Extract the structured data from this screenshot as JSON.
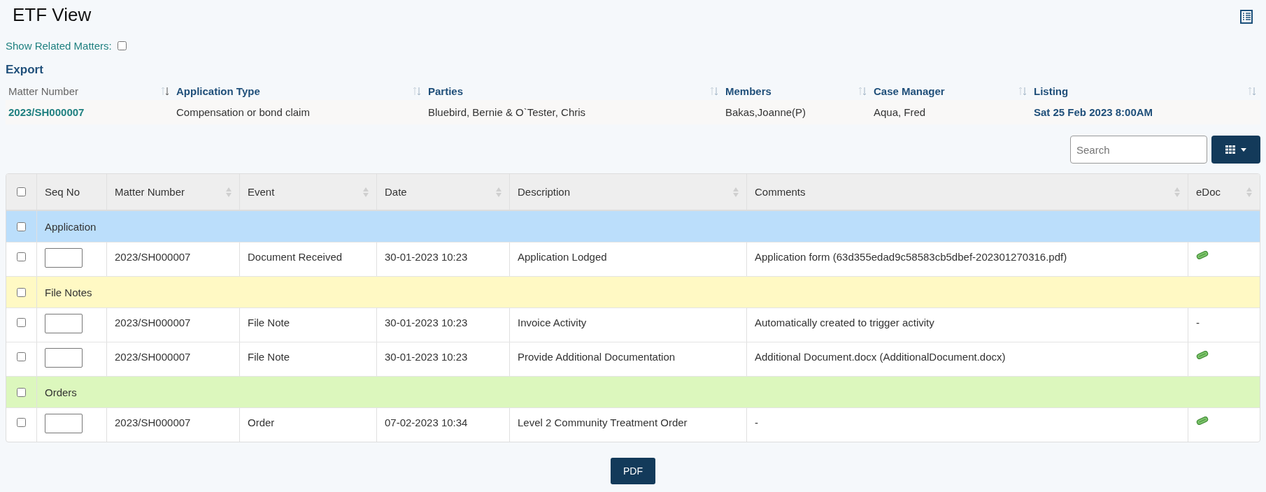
{
  "page": {
    "title": "ETF View"
  },
  "show_related": {
    "label": "Show Related Matters:",
    "checked": false
  },
  "export": {
    "title": "Export",
    "columns": [
      "Matter Number",
      "Application Type",
      "Parties",
      "Members",
      "Case Manager",
      "Listing"
    ],
    "values": [
      "2023/SH000007",
      "Compensation or bond claim",
      "Bluebird, Bernie & O`Tester, Chris",
      "Bakas,Joanne(P)",
      "Aqua, Fred",
      "Sat 25 Feb 2023 8:00AM"
    ]
  },
  "search": {
    "placeholder": "Search"
  },
  "table": {
    "select_all_checked": false,
    "columns": [
      "Seq No",
      "Matter Number",
      "Event",
      "Date",
      "Description",
      "Comments",
      "eDoc"
    ],
    "rows": [
      {
        "kind": "group",
        "label": "Application",
        "color": "#bbdefb",
        "checked": false
      },
      {
        "kind": "item",
        "checked": false,
        "matter": "2023/SH000007",
        "event": "Document Received",
        "date": "30-01-2023 10:23",
        "description": "Application Lodged",
        "comments": "Application form (63d355edad9c58583cb5dbef-202301270316.pdf)",
        "edoc": {
          "kind": "icon"
        }
      },
      {
        "kind": "group",
        "label": "File Notes",
        "color": "#fff9c4",
        "checked": false
      },
      {
        "kind": "item",
        "checked": false,
        "matter": "2023/SH000007",
        "event": "File Note",
        "date": "30-01-2023 10:23",
        "description": "Invoice Activity",
        "comments": "Automatically created to trigger activity",
        "edoc": {
          "kind": "text",
          "text": "-"
        }
      },
      {
        "kind": "item",
        "checked": false,
        "matter": "2023/SH000007",
        "event": "File Note",
        "date": "30-01-2023 10:23",
        "description": "Provide Additional Documentation",
        "comments": "Additional Document.docx (AdditionalDocument.docx)",
        "edoc": {
          "kind": "icon"
        }
      },
      {
        "kind": "group",
        "label": "Orders",
        "color": "#dcf7bd",
        "checked": false
      },
      {
        "kind": "item",
        "checked": false,
        "matter": "2023/SH000007",
        "event": "Order",
        "date": "07-02-2023 10:34",
        "description": "Level 2 Community Treatment Order",
        "comments": "-",
        "edoc": {
          "kind": "icon"
        }
      }
    ]
  },
  "pdf_button": "PDF"
}
